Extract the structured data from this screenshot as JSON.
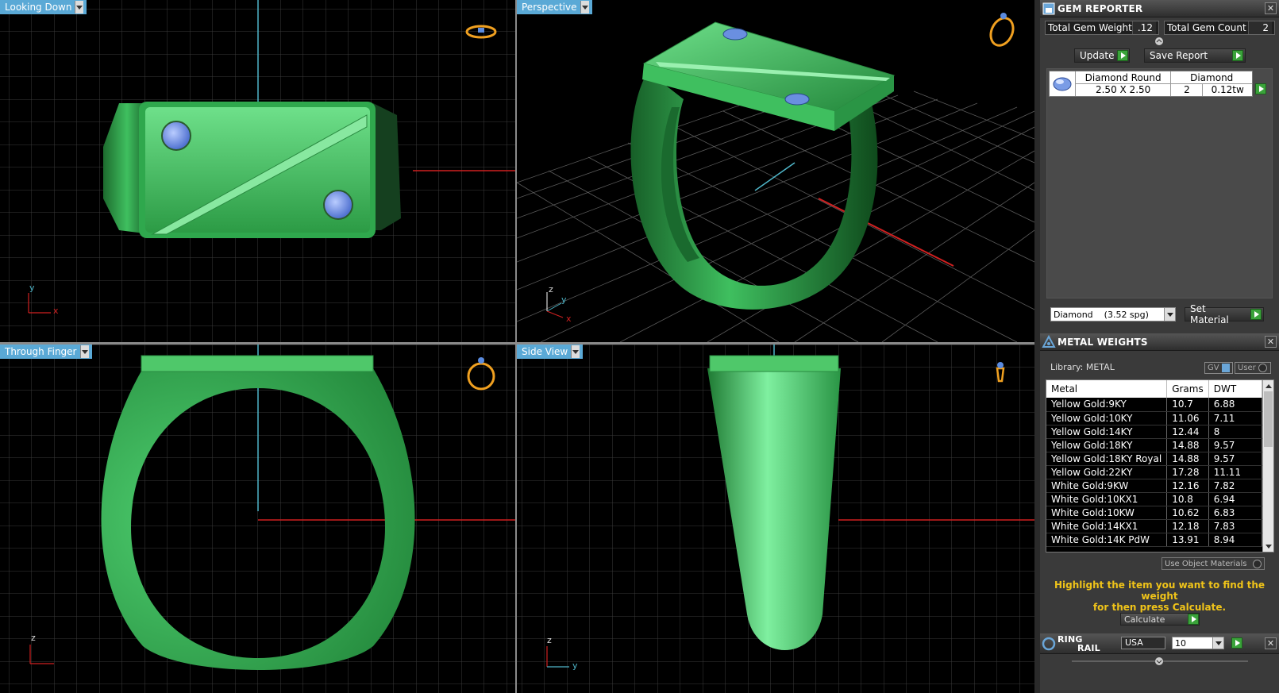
{
  "viewports": {
    "top_left": {
      "label": "Looking Down",
      "axes": [
        "y",
        "x"
      ]
    },
    "top_right": {
      "label": "Perspective",
      "axes": [
        "z",
        "y",
        "x"
      ]
    },
    "bottom_left": {
      "label": "Through Finger",
      "axes": [
        "z"
      ]
    },
    "bottom_right": {
      "label": "Side View",
      "axes": [
        "z",
        "y"
      ]
    }
  },
  "gem_reporter": {
    "title": "GEM REPORTER",
    "total_weight_label": "Total Gem Weight",
    "total_weight_value": ".12",
    "total_count_label": "Total Gem Count",
    "total_count_value": "2",
    "update_label": "Update",
    "save_label": "Save Report",
    "gem": {
      "shape": "Diamond Round",
      "size": "2.50 X 2.50",
      "material": "Diamond",
      "count": "2",
      "weight": "0.12tw"
    },
    "material_select": "Diamond    (3.52 spg)",
    "set_material_label": "Set Material"
  },
  "metal_weights": {
    "title": "METAL WEIGHTS",
    "library_label": "Library: METAL",
    "gv_label": "GV",
    "user_label": "User",
    "columns": [
      "Metal",
      "Grams",
      "DWT"
    ],
    "rows": [
      [
        "Yellow Gold:9KY",
        "10.7",
        "6.88"
      ],
      [
        "Yellow Gold:10KY",
        "11.06",
        "7.11"
      ],
      [
        "Yellow Gold:14KY",
        "12.44",
        "8"
      ],
      [
        "Yellow Gold:18KY",
        "14.88",
        "9.57"
      ],
      [
        "Yellow Gold:18KY Royal",
        "14.88",
        "9.57"
      ],
      [
        "Yellow Gold:22KY",
        "17.28",
        "11.11"
      ],
      [
        "White Gold:9KW",
        "12.16",
        "7.82"
      ],
      [
        "White Gold:10KX1",
        "10.8",
        "6.94"
      ],
      [
        "White Gold:10KW",
        "10.62",
        "6.83"
      ],
      [
        "White Gold:14KX1",
        "12.18",
        "7.83"
      ],
      [
        "White Gold:14K PdW",
        "13.91",
        "8.94"
      ]
    ],
    "use_object_label": "Use Object Materials",
    "hint_line1": "Highlight the item you want to find the weight",
    "hint_line2": "for then press Calculate.",
    "calculate_label": "Calculate"
  },
  "ring_rail": {
    "title_line1": "RING",
    "title_line2": "RAIL",
    "standard": "USA",
    "size": "10"
  },
  "colors": {
    "ring_green": "#3fbf5f",
    "gem_blue": "#6a8fe0",
    "grid": "#3a3a3a",
    "axis_red": "#d02020",
    "axis_cyan": "#4fb6c9",
    "label_bg": "#5aa9d6",
    "hint_yellow": "#f0c419"
  }
}
